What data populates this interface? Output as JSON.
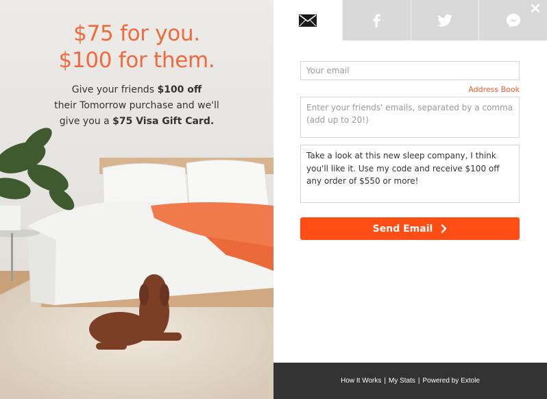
{
  "promo": {
    "headline_line1": "$75 for you.",
    "headline_line2": "$100 for them.",
    "sub_part1": "Give your friends ",
    "sub_bold1": "$100 off",
    "sub_part2": "their Tomorrow purchase and we'll",
    "sub_part3": "give you a ",
    "sub_bold2": "$75 Visa Gift Card."
  },
  "tabs": [
    {
      "icon": "envelope-icon",
      "active": true
    },
    {
      "icon": "facebook-icon",
      "active": false
    },
    {
      "icon": "twitter-icon",
      "active": false
    },
    {
      "icon": "messenger-icon",
      "active": false
    }
  ],
  "form": {
    "email_placeholder": "Your email",
    "address_book": "Address Book",
    "friends_placeholder": "Enter your friends' emails, separated by a comma (add up to 20!)",
    "message": "Take a look at this new sleep company, I think you'll like it. Use my code and receive $100 off any order of $550 or more!",
    "send_label": "Send Email"
  },
  "footer": {
    "how_it_works": "How It Works",
    "my_stats": "My Stats",
    "powered_by": "Powered by Extole",
    "separator": "|"
  },
  "colors": {
    "accent": "#f26a3c",
    "button": "#fe4d15",
    "footer_bg": "#333333",
    "tab_bg": "#d9d9d9"
  }
}
